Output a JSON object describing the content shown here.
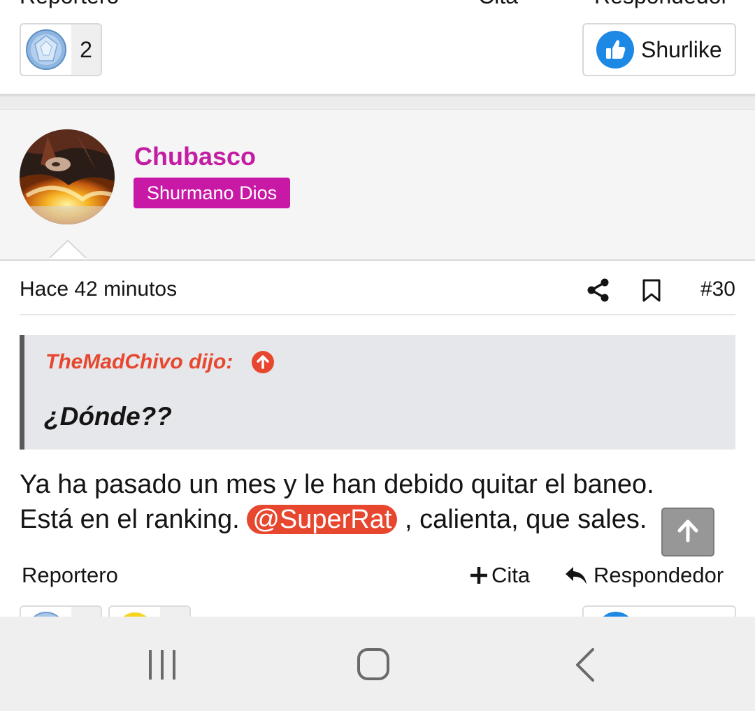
{
  "prev_post": {
    "reporter_label": "Reportero",
    "quote_label": "Cita",
    "reply_label": "Respondedor",
    "reaction_count": "2",
    "like_label": "Shurlike"
  },
  "post": {
    "username": "Chubasco",
    "user_title": "Shurmano Dios",
    "time": "Hace 42 minutos",
    "post_number": "#30",
    "quote": {
      "author": "TheMadChivo dijo:",
      "text": "¿Dónde??"
    },
    "body_line1": "Ya ha pasado un mes y le han debido quitar el baneo.",
    "body_line2_prefix": "Está en el ranking. ",
    "mention": "@SuperRat",
    "body_line2_suffix": " , calienta, que sales.",
    "actions": {
      "report": "Reportero",
      "quote": "Cita",
      "reply": "Respondedor"
    }
  },
  "colors": {
    "username": "#c41ca2",
    "badge": "#c819a6",
    "quote_author": "#e8472f",
    "mention": "#e8472f",
    "like_blue": "#1e88e5"
  },
  "icons": [
    "gem-icon",
    "thumbs-up-icon",
    "share-icon",
    "bookmark-icon",
    "arrow-up-circle-icon",
    "plus-icon",
    "reply-icon",
    "arrow-up-icon",
    "recent-apps-icon",
    "home-icon",
    "back-icon"
  ]
}
